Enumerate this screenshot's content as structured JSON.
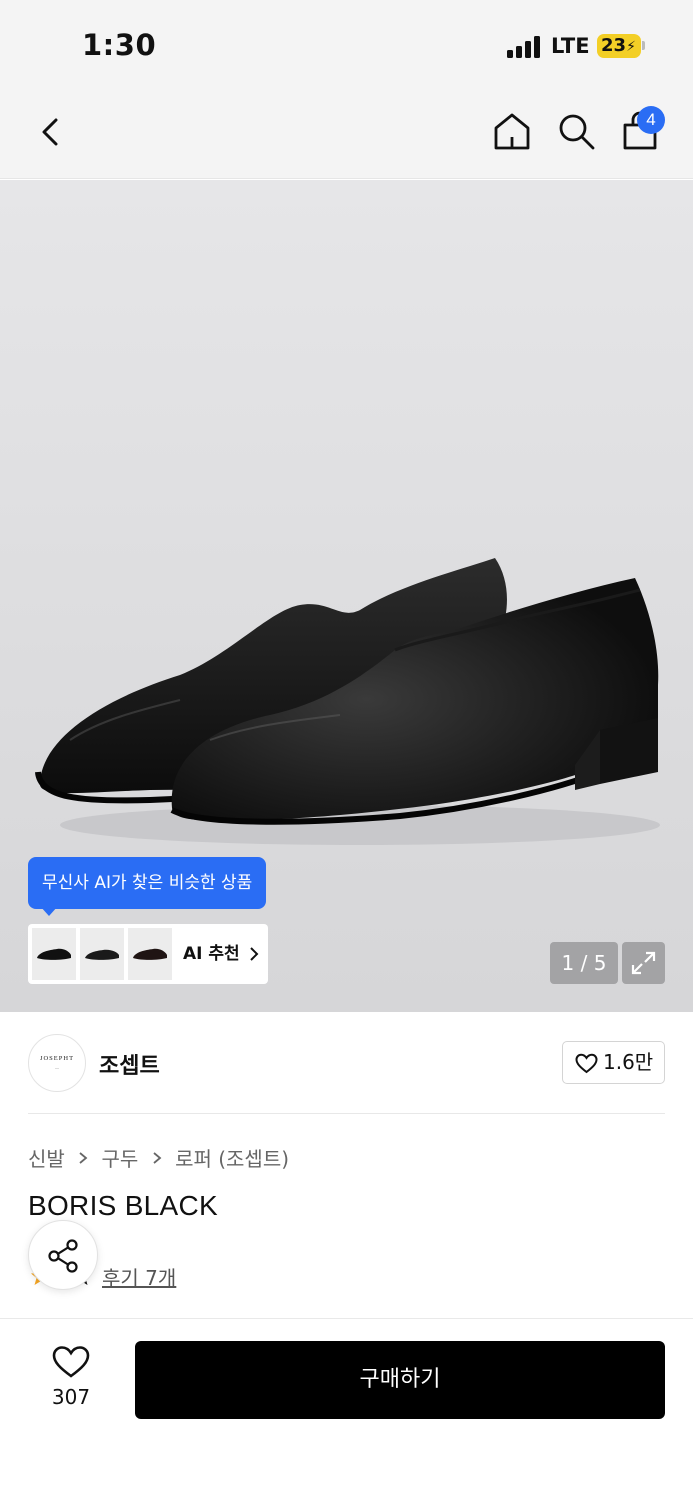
{
  "status_bar": {
    "time": "1:30",
    "network": "LTE",
    "battery": "23"
  },
  "nav": {
    "cart_count": "4"
  },
  "gallery": {
    "ai_tooltip": "무신사 AI가 찾은 비슷한 상품",
    "ai_recommend_label": "AI 추천",
    "image_counter": "1 / 5"
  },
  "brand": {
    "logo_text": "JOSEPHT",
    "name": "조셉트",
    "like_count": "1.6만"
  },
  "product": {
    "breadcrumb": [
      "신발",
      "구두",
      "로퍼 (조셉트)"
    ],
    "title": "BORIS BLACK",
    "review_link": "후기 7개"
  },
  "bottom_bar": {
    "wish_count": "307",
    "buy_label": "구매하기"
  },
  "colors": {
    "accent_blue": "#2a6df4",
    "battery_yellow": "#f3cf26",
    "buy_button": "#000000"
  }
}
